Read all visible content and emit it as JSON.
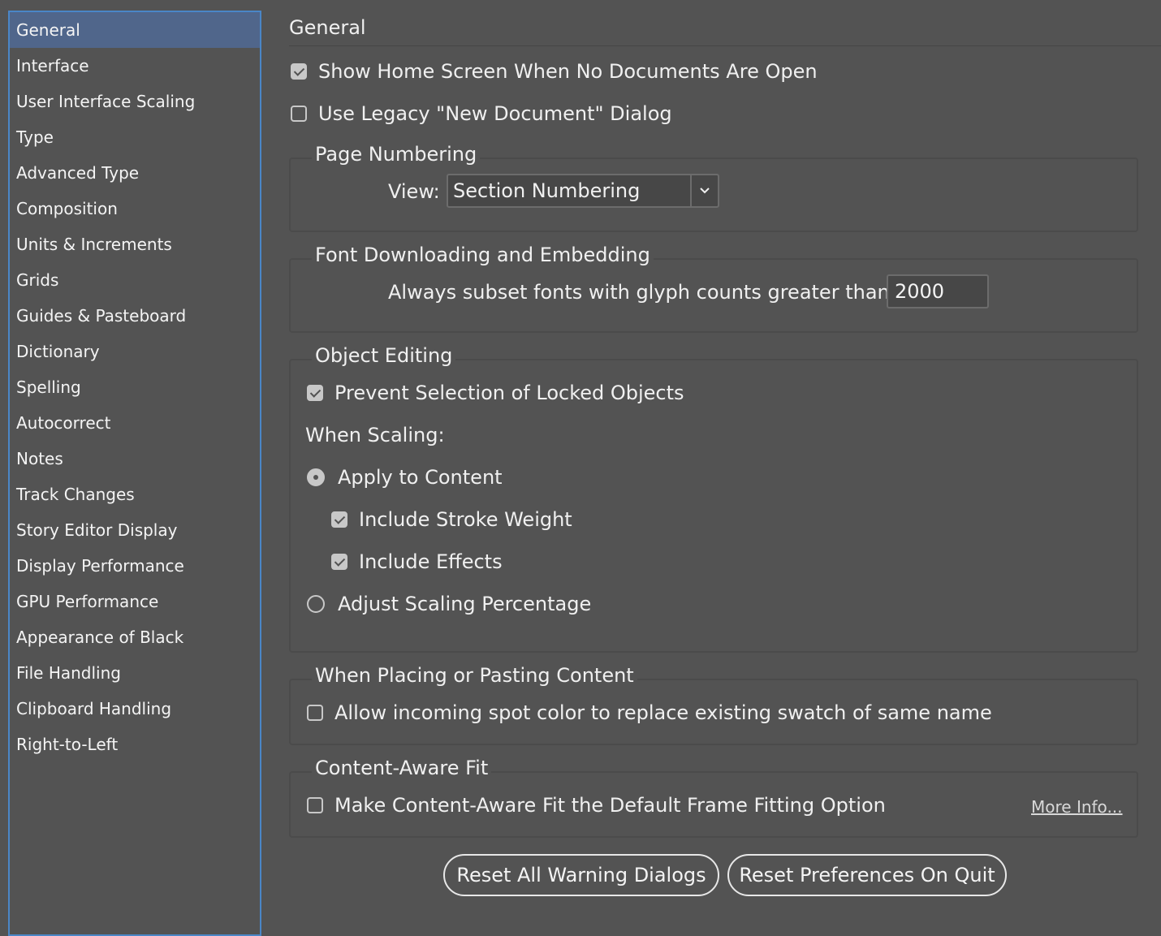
{
  "sidebar": {
    "items": [
      {
        "label": "General",
        "selected": true
      },
      {
        "label": "Interface"
      },
      {
        "label": "User Interface Scaling"
      },
      {
        "label": "Type"
      },
      {
        "label": "Advanced Type"
      },
      {
        "label": "Composition"
      },
      {
        "label": "Units & Increments"
      },
      {
        "label": "Grids"
      },
      {
        "label": "Guides & Pasteboard"
      },
      {
        "label": "Dictionary"
      },
      {
        "label": "Spelling"
      },
      {
        "label": "Autocorrect"
      },
      {
        "label": "Notes"
      },
      {
        "label": "Track Changes"
      },
      {
        "label": "Story Editor Display"
      },
      {
        "label": "Display Performance"
      },
      {
        "label": "GPU Performance"
      },
      {
        "label": "Appearance of Black"
      },
      {
        "label": "File Handling"
      },
      {
        "label": "Clipboard Handling"
      },
      {
        "label": "Right-to-Left"
      }
    ]
  },
  "main": {
    "title": "General",
    "show_home_screen": {
      "label": "Show Home Screen When No Documents Are Open",
      "checked": true
    },
    "legacy_new_document": {
      "label": "Use Legacy \"New Document\" Dialog",
      "checked": false
    },
    "page_numbering": {
      "title": "Page Numbering",
      "view_label": "View:",
      "view_value": "Section Numbering"
    },
    "font_downloading": {
      "title": "Font Downloading and Embedding",
      "subset_label": "Always subset fonts with glyph counts greater than:",
      "subset_value": "2000"
    },
    "object_editing": {
      "title": "Object Editing",
      "prevent_locked": {
        "label": "Prevent Selection of Locked Objects",
        "checked": true
      },
      "when_scaling_label": "When Scaling:",
      "apply_to_content": {
        "label": "Apply to Content",
        "selected": true
      },
      "include_stroke_weight": {
        "label": "Include Stroke Weight",
        "checked": true
      },
      "include_effects": {
        "label": "Include Effects",
        "checked": true
      },
      "adjust_scaling": {
        "label": "Adjust Scaling Percentage",
        "selected": false
      }
    },
    "placing": {
      "title": "When Placing or Pasting Content",
      "allow_spot": {
        "label": "Allow incoming spot color to replace existing swatch of same name",
        "checked": false
      }
    },
    "content_aware": {
      "title": "Content-Aware Fit",
      "make_default": {
        "label": "Make Content-Aware Fit the Default Frame Fitting Option",
        "checked": false
      },
      "more_info": "More Info..."
    },
    "buttons": {
      "reset_warnings": "Reset All Warning Dialogs",
      "reset_prefs": "Reset Preferences On Quit"
    }
  },
  "colors": {
    "background": "#535353",
    "selection": "#50668b",
    "accent_border": "#4a86c7"
  }
}
